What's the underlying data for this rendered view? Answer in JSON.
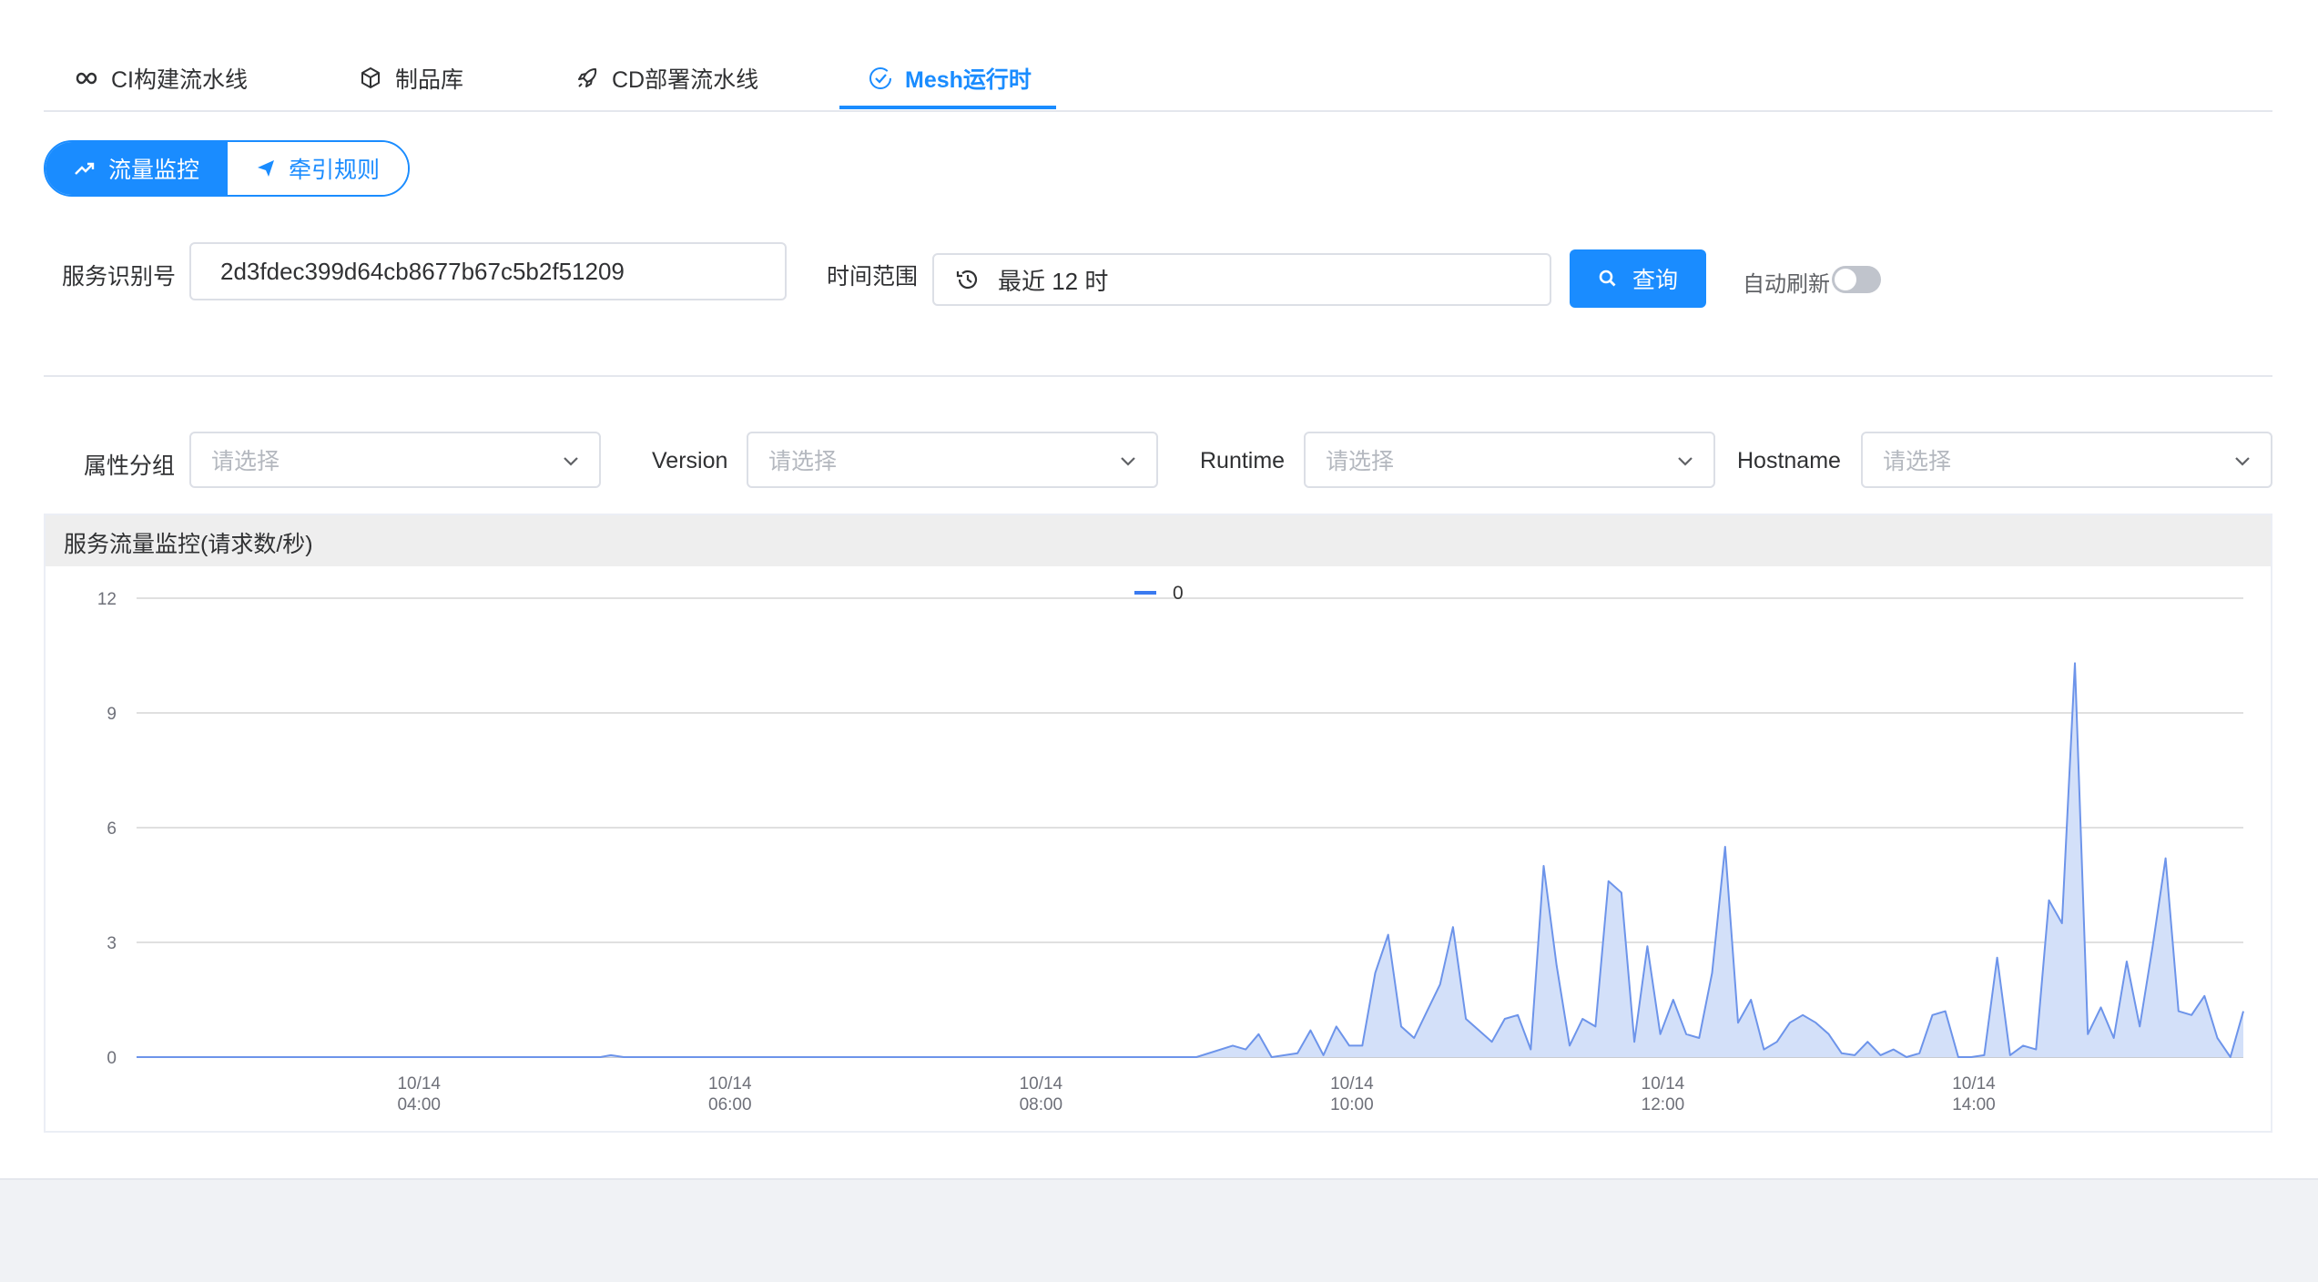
{
  "tabs": [
    {
      "label": "CI构建流水线",
      "icon": "infinity-icon"
    },
    {
      "label": "制品库",
      "icon": "cube-icon"
    },
    {
      "label": "CD部署流水线",
      "icon": "rocket-icon"
    },
    {
      "label": "Mesh运行时",
      "icon": "check-circle-icon"
    }
  ],
  "active_tab": "Mesh运行时",
  "segment": {
    "traffic_label": "流量监控",
    "rules_label": "牵引规则",
    "selected": "流量监控"
  },
  "form": {
    "service_id_label": "服务识别号",
    "service_id_value": "2d3fdec399d64cb8677b67c5b2f51209",
    "time_range_label": "时间范围",
    "time_range_value": "最近 12 时",
    "query_label": "查询",
    "auto_refresh_label": "自动刷新",
    "auto_refresh_on": false
  },
  "filters": [
    {
      "label": "属性分组",
      "placeholder": "请选择"
    },
    {
      "label": "Version",
      "placeholder": "请选择"
    },
    {
      "label": "Runtime",
      "placeholder": "请选择"
    },
    {
      "label": "Hostname",
      "placeholder": "请选择"
    }
  ],
  "chart": {
    "title": "服务流量监控(请求数/秒)",
    "accent_color": "#6d94ea",
    "fill_color": "#d3e0f9"
  },
  "chart_data": {
    "type": "area",
    "title": "服务流量监控(请求数/秒)",
    "series": [
      {
        "name": "0"
      }
    ],
    "legend_position": "top-center",
    "grid": true,
    "ylim": [
      0,
      12
    ],
    "y_ticks": [
      0,
      3,
      6,
      9,
      12
    ],
    "x_ticks": [
      "10/14 04:00",
      "10/14 06:00",
      "10/14 08:00",
      "10/14 10:00",
      "10/14 12:00",
      "10/14 14:00"
    ],
    "points": [
      [
        "02:11",
        0
      ],
      [
        "05:10",
        0
      ],
      [
        "05:14",
        0.05
      ],
      [
        "05:19",
        0
      ],
      [
        "09:00",
        0
      ],
      [
        "09:14",
        0.3
      ],
      [
        "09:19",
        0.2
      ],
      [
        "09:24",
        0.6
      ],
      [
        "09:29",
        0
      ],
      [
        "09:34",
        0.05
      ],
      [
        "09:39",
        0.1
      ],
      [
        "09:44",
        0.7
      ],
      [
        "09:49",
        0.05
      ],
      [
        "09:54",
        0.8
      ],
      [
        "09:59",
        0.3
      ],
      [
        "10:04",
        0.3
      ],
      [
        "10:09",
        2.2
      ],
      [
        "10:14",
        3.2
      ],
      [
        "10:19",
        0.8
      ],
      [
        "10:24",
        0.5
      ],
      [
        "10:29",
        1.2
      ],
      [
        "10:34",
        1.9
      ],
      [
        "10:39",
        3.4
      ],
      [
        "10:44",
        1.0
      ],
      [
        "10:49",
        0.7
      ],
      [
        "10:54",
        0.4
      ],
      [
        "10:59",
        1.0
      ],
      [
        "11:04",
        1.1
      ],
      [
        "11:09",
        0.2
      ],
      [
        "11:14",
        5.0
      ],
      [
        "11:19",
        2.4
      ],
      [
        "11:24",
        0.3
      ],
      [
        "11:29",
        1.0
      ],
      [
        "11:34",
        0.8
      ],
      [
        "11:39",
        4.6
      ],
      [
        "11:44",
        4.3
      ],
      [
        "11:49",
        0.4
      ],
      [
        "11:54",
        2.9
      ],
      [
        "11:59",
        0.6
      ],
      [
        "12:04",
        1.5
      ],
      [
        "12:09",
        0.6
      ],
      [
        "12:14",
        0.5
      ],
      [
        "12:19",
        2.2
      ],
      [
        "12:24",
        5.5
      ],
      [
        "12:29",
        0.9
      ],
      [
        "12:34",
        1.5
      ],
      [
        "12:39",
        0.2
      ],
      [
        "12:44",
        0.4
      ],
      [
        "12:49",
        0.9
      ],
      [
        "12:54",
        1.1
      ],
      [
        "12:59",
        0.9
      ],
      [
        "13:04",
        0.6
      ],
      [
        "13:09",
        0.1
      ],
      [
        "13:14",
        0.05
      ],
      [
        "13:19",
        0.4
      ],
      [
        "13:24",
        0.05
      ],
      [
        "13:29",
        0.2
      ],
      [
        "13:34",
        0.0
      ],
      [
        "13:39",
        0.1
      ],
      [
        "13:44",
        1.1
      ],
      [
        "13:49",
        1.2
      ],
      [
        "13:54",
        0.0
      ],
      [
        "13:59",
        0.0
      ],
      [
        "14:04",
        0.05
      ],
      [
        "14:09",
        2.6
      ],
      [
        "14:14",
        0.05
      ],
      [
        "14:19",
        0.3
      ],
      [
        "14:24",
        0.2
      ],
      [
        "14:29",
        4.1
      ],
      [
        "14:34",
        3.5
      ],
      [
        "14:39",
        10.3
      ],
      [
        "14:44",
        0.6
      ],
      [
        "14:49",
        1.3
      ],
      [
        "14:54",
        0.5
      ],
      [
        "14:59",
        2.5
      ],
      [
        "15:04",
        0.8
      ],
      [
        "15:09",
        2.9
      ],
      [
        "15:14",
        5.2
      ],
      [
        "15:19",
        1.2
      ],
      [
        "15:24",
        1.1
      ],
      [
        "15:29",
        1.6
      ],
      [
        "15:34",
        0.5
      ],
      [
        "15:39",
        0.0
      ],
      [
        "15:44",
        1.2
      ]
    ]
  }
}
